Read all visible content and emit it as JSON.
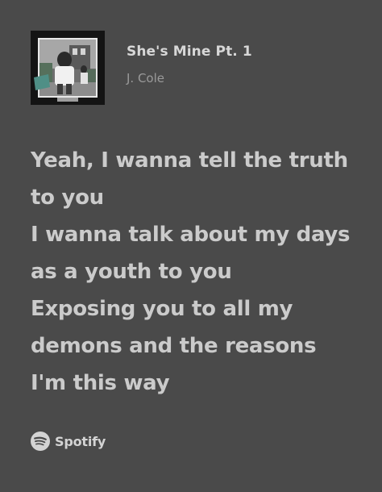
{
  "track": {
    "title": "She's Mine Pt. 1",
    "artist": "J. Cole",
    "album_art": "album-cover-image"
  },
  "lyrics": [
    "Yeah, I wanna tell the truth",
    "to you",
    "I wanna talk about my days",
    "as a youth to you",
    "Exposing you to all my",
    "demons and the reasons",
    "I'm this way"
  ],
  "brand": {
    "icon": "spotify-icon",
    "name": "Spotify"
  },
  "colors": {
    "background": "#4a4a4a",
    "lyrics_text": "#cbcbcb",
    "title_text": "#d7d7d7",
    "artist_text": "#9a9a9a"
  }
}
